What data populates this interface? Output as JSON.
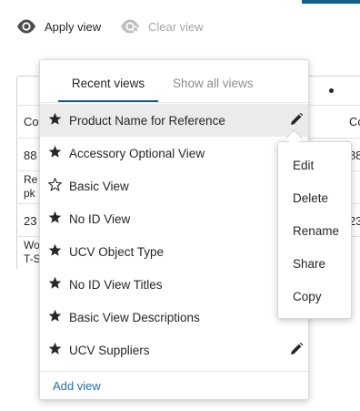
{
  "toolbar": {
    "apply_label": "Apply view",
    "clear_label": "Clear view"
  },
  "background_table": {
    "cells": [
      "Co",
      "88",
      "Re",
      "pk",
      "23",
      "Wo",
      "T-S",
      "Co",
      "88",
      "23"
    ]
  },
  "dropdown": {
    "tabs": [
      {
        "label": "Recent views",
        "active": true
      },
      {
        "label": "Show all views",
        "active": false
      }
    ],
    "items": [
      {
        "label": "Product Name for Reference",
        "favorite": true,
        "highlighted": true,
        "editable": true
      },
      {
        "label": "Accessory Optional View",
        "favorite": true,
        "highlighted": false,
        "editable": false
      },
      {
        "label": "Basic View",
        "favorite": false,
        "highlighted": false,
        "editable": false
      },
      {
        "label": "No ID View",
        "favorite": true,
        "highlighted": false,
        "editable": false
      },
      {
        "label": "UCV Object Type",
        "favorite": true,
        "highlighted": false,
        "editable": false
      },
      {
        "label": "No ID View Titles",
        "favorite": true,
        "highlighted": false,
        "editable": false
      },
      {
        "label": "Basic View Descriptions",
        "favorite": true,
        "highlighted": false,
        "editable": false
      },
      {
        "label": "UCV Suppliers",
        "favorite": true,
        "highlighted": false,
        "editable": true
      }
    ],
    "add_view_label": "Add view"
  },
  "context_menu": {
    "items": [
      "Edit",
      "Delete",
      "Rename",
      "Share",
      "Copy"
    ]
  },
  "colors": {
    "accent": "#0f5f86",
    "link": "#1f6fa6",
    "highlight": "#ebebeb",
    "disabled": "#a6a6a6"
  },
  "icons": {
    "apply": "eye-icon",
    "clear": "eye-slash-icon",
    "favorite": "star-filled-icon",
    "not_favorite": "star-outline-icon",
    "edit": "pencil-icon"
  }
}
